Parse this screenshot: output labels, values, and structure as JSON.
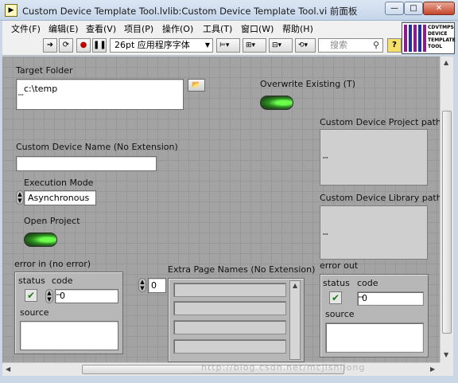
{
  "window": {
    "title": "Custom Device Template Tool.lvlib:Custom Device Template Tool.vi 前面板",
    "minimize": "—",
    "maximize": "□",
    "close": "✕"
  },
  "menu": [
    "文件(F)",
    "编辑(E)",
    "查看(V)",
    "项目(P)",
    "操作(O)",
    "工具(T)",
    "窗口(W)",
    "帮助(H)"
  ],
  "toolbar": {
    "font_selector": "26pt 应用程序字体",
    "search_placeholder": "搜索",
    "help": "?"
  },
  "vi_icon": {
    "line1": "CDVTMPS",
    "line2": "DEVICE",
    "line3": "TEMPLATE",
    "line4": "TOOL"
  },
  "controls": {
    "target_folder": {
      "label": "Target Folder",
      "value": "c:\\temp"
    },
    "overwrite_existing": {
      "label": "Overwrite Existing (T)"
    },
    "custom_device_name": {
      "label": "Custom Device Name (No Extension)",
      "value": ""
    },
    "execution_mode": {
      "label": "Execution Mode",
      "value": "Asynchronous"
    },
    "open_project": {
      "label": "Open Project"
    },
    "project_path": {
      "label": "Custom Device Project path"
    },
    "library_path": {
      "label": "Custom Device Library path"
    },
    "error_in": {
      "label": "error in (no error)",
      "status": "status",
      "code": "code",
      "code_value": "0",
      "source": "source"
    },
    "extra_pages": {
      "label": "Extra Page Names (No Extension)",
      "index": "0"
    },
    "error_out": {
      "label": "error out",
      "status": "status",
      "code": "code",
      "code_value": "0",
      "source": "source"
    }
  },
  "watermark": "http://blog.csdn.net/mcjishilong"
}
